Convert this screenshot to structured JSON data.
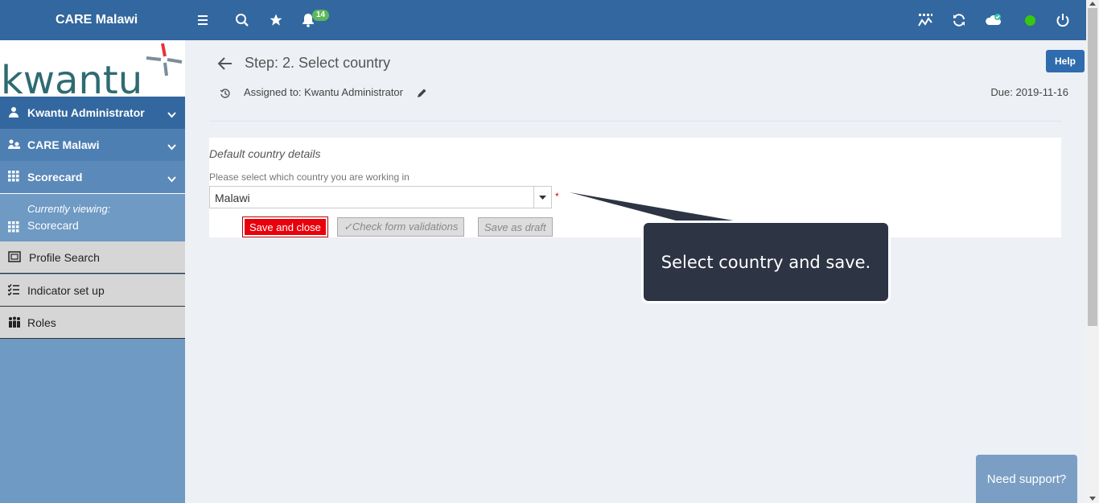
{
  "header": {
    "app_title": "CARE Malawi",
    "notification_count": "14",
    "icons": [
      "menu-icon",
      "search-icon",
      "star-icon",
      "bell-icon",
      "chart-icon",
      "sync-icon",
      "cloud-check-icon",
      "status-dot",
      "power-icon"
    ],
    "status_color": "#37c90f"
  },
  "sidebar": {
    "logo_text": "kwantu",
    "user": "Kwantu Administrator",
    "org": "CARE Malawi",
    "app": "Scorecard",
    "currently_viewing_label": "Currently viewing:",
    "currently_viewing_value": "Scorecard",
    "links": [
      "Profile Search",
      "Indicator set up",
      "Roles"
    ]
  },
  "main": {
    "step_title": "Step: 2. Select country",
    "help_label": "Help",
    "assigned": "Assigned to: Kwantu Administrator",
    "due": "Due: 2019-11-16",
    "form": {
      "section_title": "Default country details",
      "field_label": "Please select which country you are working in",
      "selected_country": "Malawi",
      "required_mark": "*",
      "save_close_label": "Save and close",
      "check_label": "✓Check form validations",
      "draft_label": "Save as draft"
    },
    "tooltip_text": "Select country and save.",
    "support_label": "Need support?"
  },
  "colors": {
    "header_bg": "#33679f",
    "sidebar_bg": "#6e9ac3",
    "save_btn": "#e8000b",
    "tooltip_bg": "#2d3444"
  }
}
